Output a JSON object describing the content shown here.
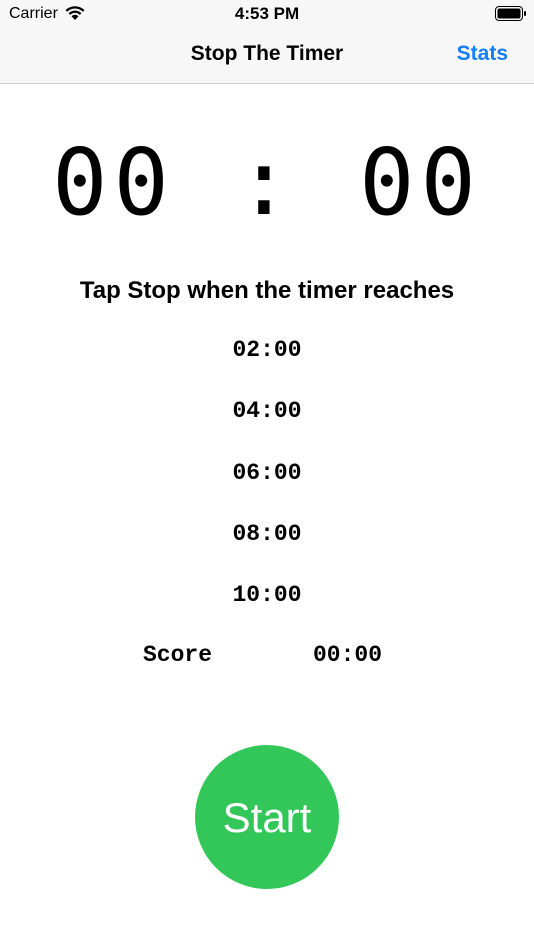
{
  "status_bar": {
    "carrier": "Carrier",
    "time": "4:53 PM"
  },
  "nav": {
    "title": "Stop The Timer",
    "stats_label": "Stats"
  },
  "timer": {
    "display": "00:00"
  },
  "instruction": "Tap Stop when the timer reaches",
  "targets": [
    "02:00",
    "04:00",
    "06:00",
    "08:00",
    "10:00"
  ],
  "score": {
    "label": "Score",
    "value": "00:00"
  },
  "start_label": "Start",
  "colors": {
    "accent": "#147efb",
    "start_button": "#33c75a"
  },
  "icons": [
    "wifi-icon",
    "battery-icon"
  ]
}
